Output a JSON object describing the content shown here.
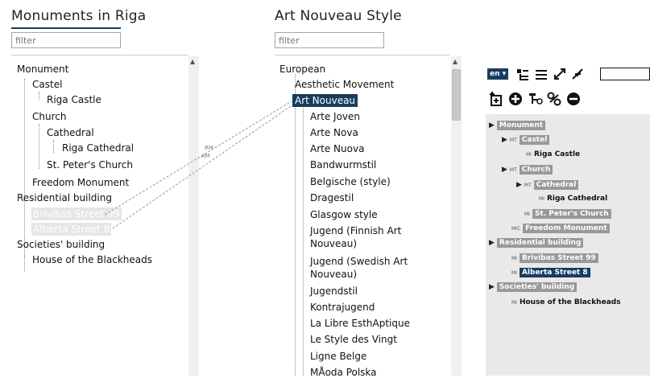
{
  "left": {
    "title": "Monuments in Riga",
    "filter_placeholder": "filter",
    "items": [
      {
        "label": "Monument"
      },
      {
        "label": "Castel"
      },
      {
        "label": "Riga Castle"
      },
      {
        "label": "Church"
      },
      {
        "label": "Cathedral"
      },
      {
        "label": "Riga Cathedral"
      },
      {
        "label": "St. Peter's Church"
      },
      {
        "label": "Freedom Monument"
      },
      {
        "label": "Residential building"
      },
      {
        "label": "Brivibas Street 99"
      },
      {
        "label": "Alberta Street 8"
      },
      {
        "label": "Societies' building"
      },
      {
        "label": "House of the Blackheads"
      }
    ]
  },
  "middle": {
    "link_labels": [
      "RM",
      "AM"
    ]
  },
  "center": {
    "title": "Art Nouveau Style",
    "filter_placeholder": "filter",
    "items": [
      {
        "label": "European"
      },
      {
        "label": "Aesthetic Movement"
      },
      {
        "label": "Art Nouveau"
      },
      {
        "label": "Arte Joven"
      },
      {
        "label": "Arte Nova"
      },
      {
        "label": "Arte Nuova"
      },
      {
        "label": "Bandwurmstil"
      },
      {
        "label": "Belgische (style)"
      },
      {
        "label": "Dragestil"
      },
      {
        "label": "Glasgow style"
      },
      {
        "label": "Jugend (Finnish Art"
      },
      {
        "label": "Nouveau)"
      },
      {
        "label": "Jugend (Swedish Art"
      },
      {
        "label": "Nouveau)"
      },
      {
        "label": "Jugendstil"
      },
      {
        "label": "Kontrajugend"
      },
      {
        "label": "La Libre EsthAptique"
      },
      {
        "label": "Le Style des Vingt"
      },
      {
        "label": "Ligne Belge"
      },
      {
        "label": "MÅoda Polska"
      }
    ]
  },
  "toolbar": {
    "lang_label": "en ▾",
    "search_value": ""
  },
  "right": {
    "nodes": [
      {
        "badge": "",
        "label": "Monument"
      },
      {
        "badge": "MT",
        "label": "Castel"
      },
      {
        "badge": "MI",
        "label": "Riga Castle"
      },
      {
        "badge": "MT",
        "label": "Church"
      },
      {
        "badge": "MT",
        "label": "Cathedral"
      },
      {
        "badge": "MI",
        "label": "Riga Cathedral"
      },
      {
        "badge": "MI",
        "label": "St. Peter's Church"
      },
      {
        "badge": "MIC",
        "label": "Freedom Monument"
      },
      {
        "badge": "",
        "label": "Residential building"
      },
      {
        "badge": "MI",
        "label": "Brivibas Street 99"
      },
      {
        "badge": "MI",
        "label": "Alberta Street 8"
      },
      {
        "badge": "",
        "label": "Societies' building"
      },
      {
        "badge": "MI",
        "label": "House of the Blackheads"
      }
    ]
  }
}
